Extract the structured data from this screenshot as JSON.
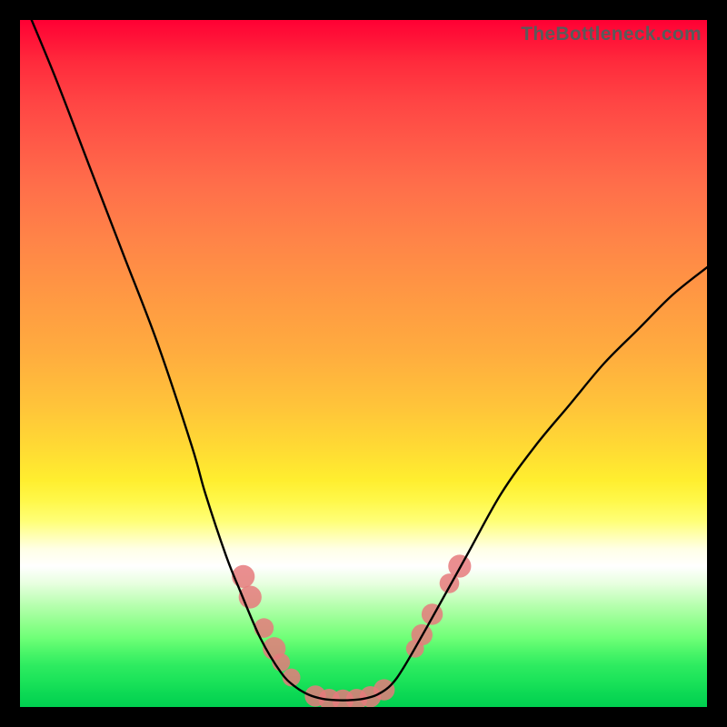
{
  "watermark": "TheBottleneck.com",
  "colors": {
    "dot": "#e67a7c",
    "line": "#000000",
    "frame": "#000000"
  },
  "chart_data": {
    "type": "line",
    "title": "",
    "xlabel": "",
    "ylabel": "",
    "xlim": [
      0,
      100
    ],
    "ylim": [
      0,
      100
    ],
    "grid": false,
    "series": [
      {
        "name": "bottleneck-curve",
        "x": [
          0,
          5,
          10,
          15,
          20,
          25,
          27,
          30,
          32,
          35,
          38,
          40,
          42,
          44,
          46,
          48,
          50,
          52,
          54,
          56,
          60,
          65,
          70,
          75,
          80,
          85,
          90,
          95,
          100
        ],
        "y": [
          104,
          92,
          79,
          66,
          53,
          38,
          31,
          22,
          17,
          10,
          5,
          3,
          1.8,
          1.2,
          1.0,
          1.0,
          1.2,
          1.8,
          3.2,
          6,
          13,
          22,
          31,
          38,
          44,
          50,
          55,
          60,
          64
        ]
      }
    ],
    "scatter": {
      "name": "highlight-dots",
      "points": [
        {
          "x": 32.5,
          "y": 19.0,
          "r": 1.4
        },
        {
          "x": 33.5,
          "y": 16.0,
          "r": 1.4
        },
        {
          "x": 35.5,
          "y": 11.5,
          "r": 1.2
        },
        {
          "x": 37.0,
          "y": 8.5,
          "r": 1.4
        },
        {
          "x": 38.0,
          "y": 6.5,
          "r": 1.1
        },
        {
          "x": 39.5,
          "y": 4.3,
          "r": 1.1
        },
        {
          "x": 43.0,
          "y": 1.6,
          "r": 1.3
        },
        {
          "x": 45.0,
          "y": 1.1,
          "r": 1.3
        },
        {
          "x": 47.0,
          "y": 1.0,
          "r": 1.3
        },
        {
          "x": 49.0,
          "y": 1.1,
          "r": 1.3
        },
        {
          "x": 51.0,
          "y": 1.5,
          "r": 1.3
        },
        {
          "x": 53.0,
          "y": 2.5,
          "r": 1.3
        },
        {
          "x": 57.5,
          "y": 8.5,
          "r": 1.1
        },
        {
          "x": 58.5,
          "y": 10.5,
          "r": 1.3
        },
        {
          "x": 60.0,
          "y": 13.5,
          "r": 1.3
        },
        {
          "x": 62.5,
          "y": 18.0,
          "r": 1.2
        },
        {
          "x": 64.0,
          "y": 20.5,
          "r": 1.4
        }
      ]
    }
  }
}
